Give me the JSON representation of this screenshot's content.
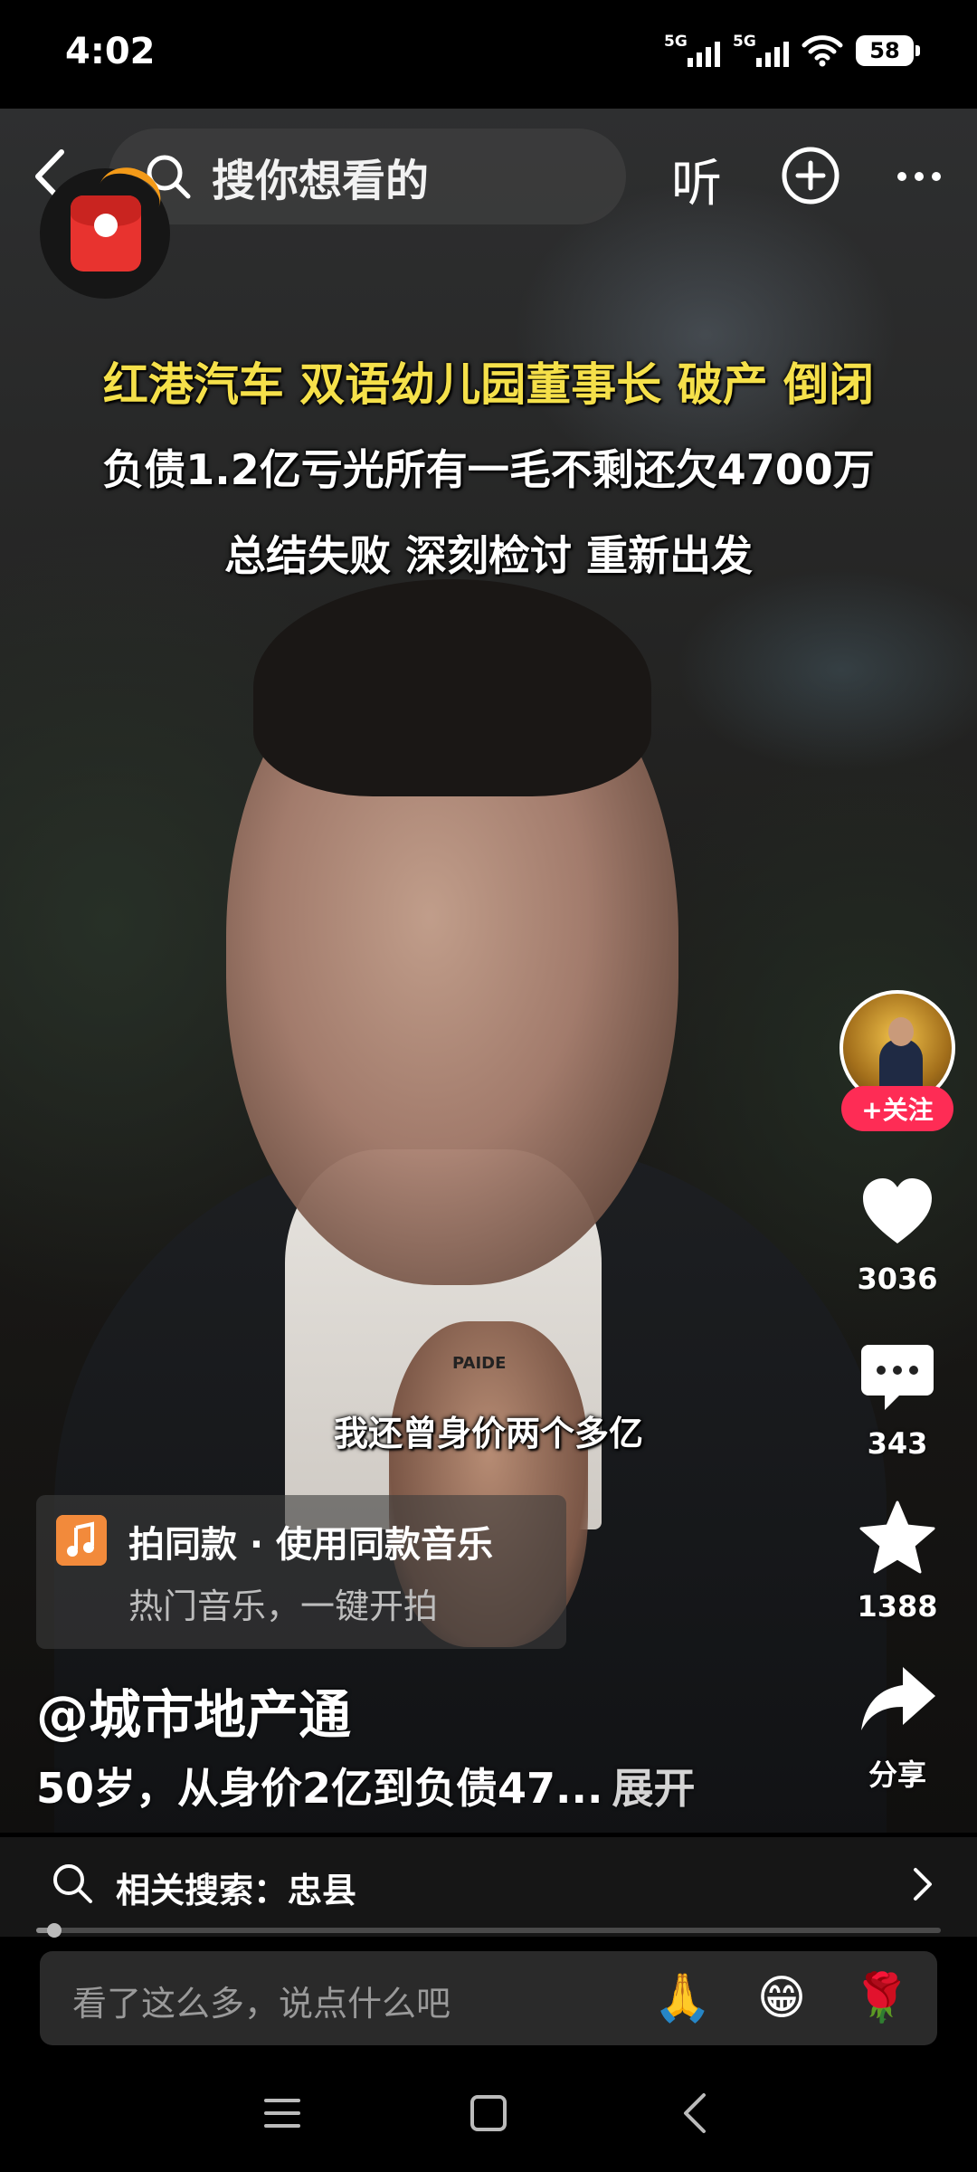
{
  "status_bar": {
    "time": "4:02",
    "signal_1": "5G",
    "signal_2": "5G",
    "battery": "58"
  },
  "top_bar": {
    "search_placeholder": "搜你想看的",
    "listen_label": "听",
    "icons": [
      "back-icon",
      "search-icon",
      "plus-icon",
      "more-icon",
      "red-packet-icon"
    ]
  },
  "video": {
    "caption_line_1": "红港汽车 双语幼儿园董事长 破产 倒闭",
    "caption_line_2": "负债1.2亿亏光所有一毛不剩还欠4700万",
    "caption_line_3": "总结失败 深刻检讨 重新出发",
    "subtitle": "我还曾身价两个多亿",
    "shirt_brand": "PAIDE"
  },
  "right_rail": {
    "follow_label": "+关注",
    "likes": "3036",
    "comments": "343",
    "favorites": "1388",
    "share_label": "分享"
  },
  "music": {
    "title": "拍同款 · 使用同款音乐",
    "subtitle": "热门音乐，一键开拍"
  },
  "post": {
    "author": "@城市地产通",
    "description": "50岁，从身价2亿到负债47...",
    "expand_label": "展开"
  },
  "related_search": {
    "label": "相关搜索：忠县"
  },
  "progress": {
    "value": 0.02
  },
  "comment_bar": {
    "placeholder": "看了这么多，说点什么吧",
    "emojis": [
      "🙏",
      "😁",
      "🌹"
    ]
  },
  "colors": {
    "accent": "#fe2c55",
    "caption_yellow": "#f5e04a",
    "music_orange": "#f28a3b"
  }
}
